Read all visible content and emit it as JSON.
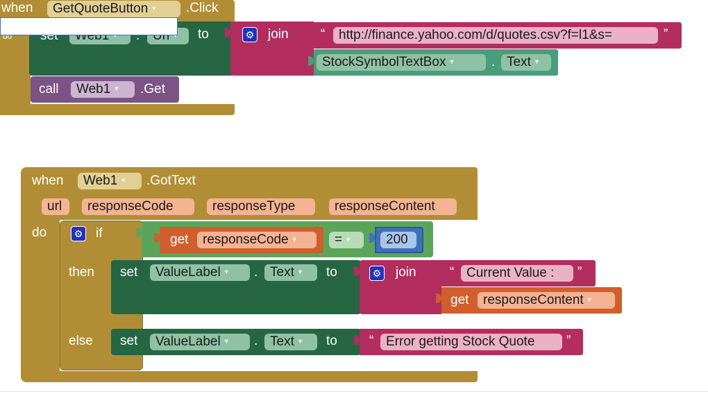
{
  "block1": {
    "when": "when",
    "component": "GetQuoteButton",
    "event": ".Click",
    "do_label": "do",
    "set_label": "set",
    "set_component": "Web1",
    "set_property": "Url",
    "dot": ".",
    "to_label": "to",
    "join_label": "join",
    "quote_open": "“",
    "quote_close": "”",
    "url_string": "http://finance.yahoo.com/d/quotes.csv?f=l1&s=",
    "textbox_component": "StockSymbolTextBox",
    "textbox_property": "Text",
    "call_label": "call",
    "call_component": "Web1",
    "call_method": ".Get"
  },
  "block2": {
    "when": "when",
    "component": "Web1",
    "event": ".GotText",
    "params": [
      "url",
      "responseCode",
      "responseType",
      "responseContent"
    ],
    "do_label": "do",
    "if_label": "if",
    "get_label": "get",
    "get_var": "responseCode",
    "op": "=",
    "number": "200",
    "then_label": "then",
    "else_label": "else",
    "set_label": "set",
    "set_component": "ValueLabel",
    "set_property": "Text",
    "dot": ".",
    "to_label": "to",
    "join_label": "join",
    "quote_open": "“",
    "quote_close": "”",
    "current_value": "Current Value :",
    "get_label2": "get",
    "get_var2": "responseContent",
    "set_label2": "set",
    "set_component2": "ValueLabel",
    "set_property2": "Text",
    "to_label2": "to",
    "error_string": "Error getting Stock Quote"
  },
  "colors": {
    "event_block": "#b18e35",
    "component_setter": "#266643",
    "text_block": "#b32d5e",
    "local_variable": "#d05f2d",
    "method_call": "#7c5385",
    "logic": "#5ba55b",
    "math": "#3f71b5"
  },
  "icons": [
    "dropdown-arrow-icon",
    "mutator-gear-icon"
  ]
}
